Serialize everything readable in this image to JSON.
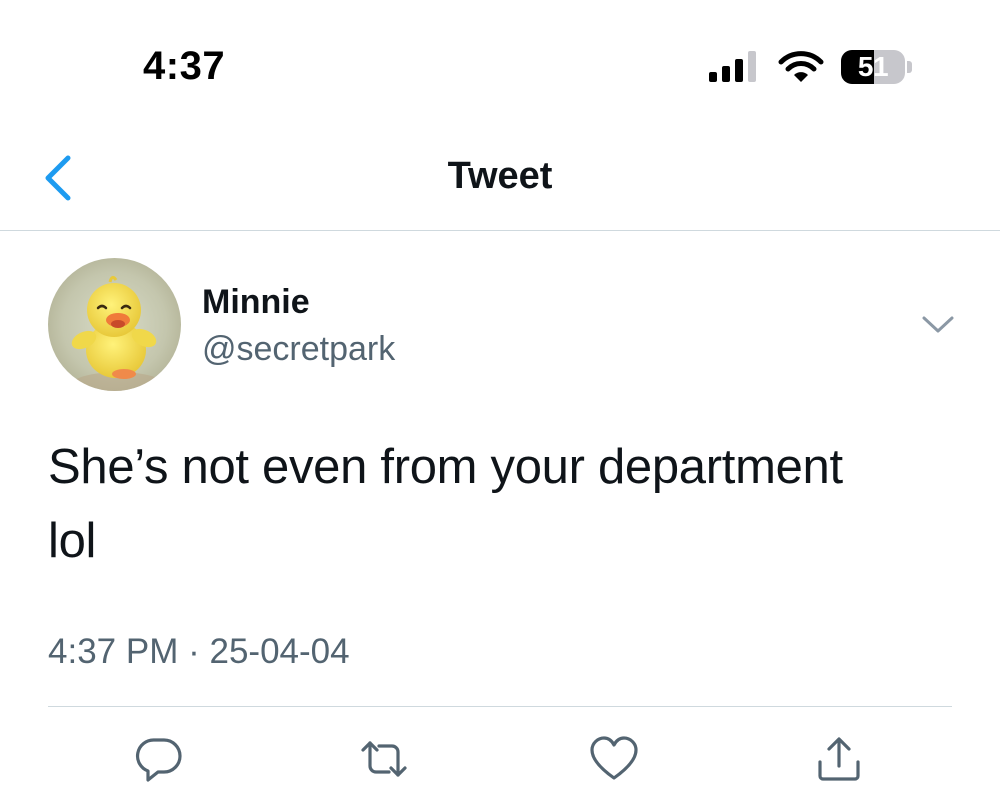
{
  "status_bar": {
    "time": "4:37",
    "battery_level": "51",
    "battery_fraction": 0.51
  },
  "nav": {
    "title": "Tweet",
    "back_icon": "chevron-left-icon",
    "accent_color": "#1d9bf0"
  },
  "tweet": {
    "display_name": "Minnie",
    "handle": "@secretpark",
    "text_line_1": "She’s not even from your department",
    "text_line_2": "lol",
    "time": "4:37 PM",
    "separator": "·",
    "date": "25-04-04",
    "avatar": "yellow-duckling-avatar"
  },
  "actions": [
    {
      "name": "reply",
      "icon": "comment-icon"
    },
    {
      "name": "retweet",
      "icon": "retweet-icon"
    },
    {
      "name": "like",
      "icon": "heart-icon"
    },
    {
      "name": "share",
      "icon": "share-icon"
    }
  ],
  "colors": {
    "text_primary": "#0f1419",
    "text_secondary": "#536471",
    "divider": "#cfd9de",
    "accent": "#1d9bf0"
  }
}
